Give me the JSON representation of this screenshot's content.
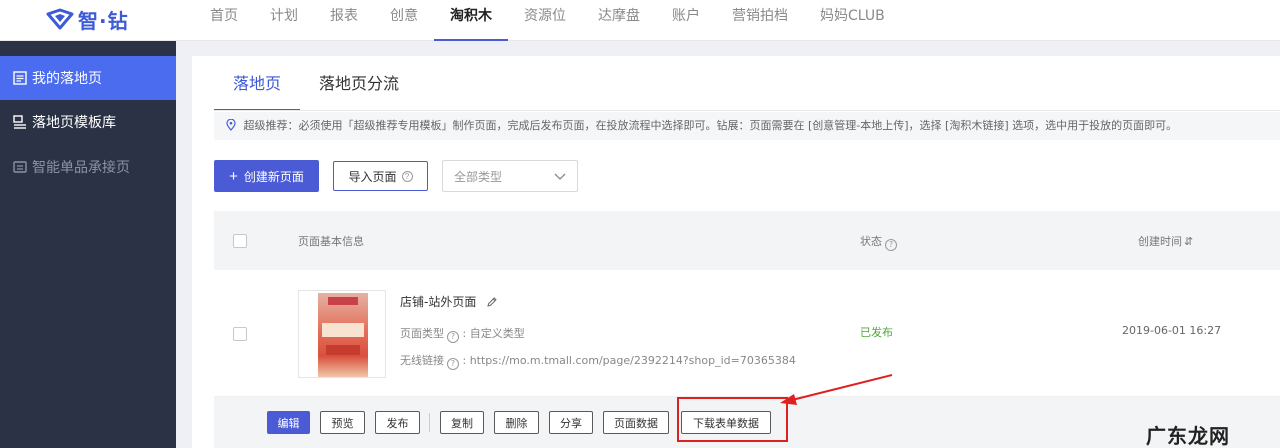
{
  "logo": {
    "text": "智·钻"
  },
  "nav": [
    {
      "label": "首页"
    },
    {
      "label": "计划"
    },
    {
      "label": "报表"
    },
    {
      "label": "创意"
    },
    {
      "label": "淘积木",
      "active": true
    },
    {
      "label": "资源位"
    },
    {
      "label": "达摩盘"
    },
    {
      "label": "账户"
    },
    {
      "label": "营销拍档"
    },
    {
      "label": "妈妈CLUB"
    }
  ],
  "sidebar": {
    "items": [
      {
        "label": "我的落地页",
        "icon": "page-icon",
        "active": true
      },
      {
        "label": "落地页模板库",
        "icon": "template-icon"
      },
      {
        "label": "智能单品承接页",
        "icon": "smart-icon",
        "disabled": true
      }
    ]
  },
  "tabs": [
    {
      "label": "落地页",
      "active": true
    },
    {
      "label": "落地页分流"
    }
  ],
  "notice": "超级推荐：必须使用「超级推荐专用模板」制作页面，完成后发布页面，在投放流程中选择即可。钻展：页面需要在 [创意管理-本地上传]，选择 [淘积木链接] 选项，选中用于投放的页面即可。",
  "toolbar": {
    "create_label": "创建新页面",
    "import_label": "导入页面",
    "type_select": "全部类型"
  },
  "table": {
    "headers": {
      "info": "页面基本信息",
      "status": "状态",
      "created": "创建时间"
    },
    "rows": [
      {
        "title": "店铺-站外页面",
        "type_label": "页面类型",
        "type_value": ": 自定义类型",
        "link_label": "无线链接",
        "link_value": ": https://mo.m.tmall.com/page/2392214?shop_id=70365384",
        "status": "已发布",
        "created": "2019-06-01 16:27"
      }
    ]
  },
  "actions": {
    "edit": "编辑",
    "preview": "预览",
    "publish": "发布",
    "copy": "复制",
    "delete": "删除",
    "share": "分享",
    "page_data": "页面数据",
    "download_form": "下载表单数据"
  },
  "watermark": "广东龙网",
  "colors": {
    "accent": "#4b5bd6",
    "sidebar_bg": "#2b3245",
    "sidebar_active": "#4c6cf0",
    "published": "#52a43a",
    "highlight": "#e02020"
  }
}
